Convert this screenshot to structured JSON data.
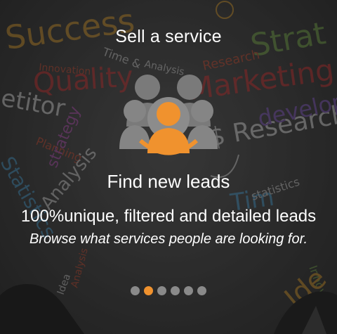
{
  "slide": {
    "top_title": "Sell a service",
    "headline": "Find new leads",
    "subheadline": "100%unique, filtered and detailed leads",
    "description": "Browse what services people are looking for."
  },
  "carousel": {
    "dot_count": 6,
    "active_index": 1
  },
  "colors": {
    "accent": "#f0922e",
    "inactive_dot": "#8a8a8a",
    "icon_gray": "#7a7a7a",
    "text": "#ffffff"
  },
  "icons": {
    "main": "user-group-icon"
  }
}
